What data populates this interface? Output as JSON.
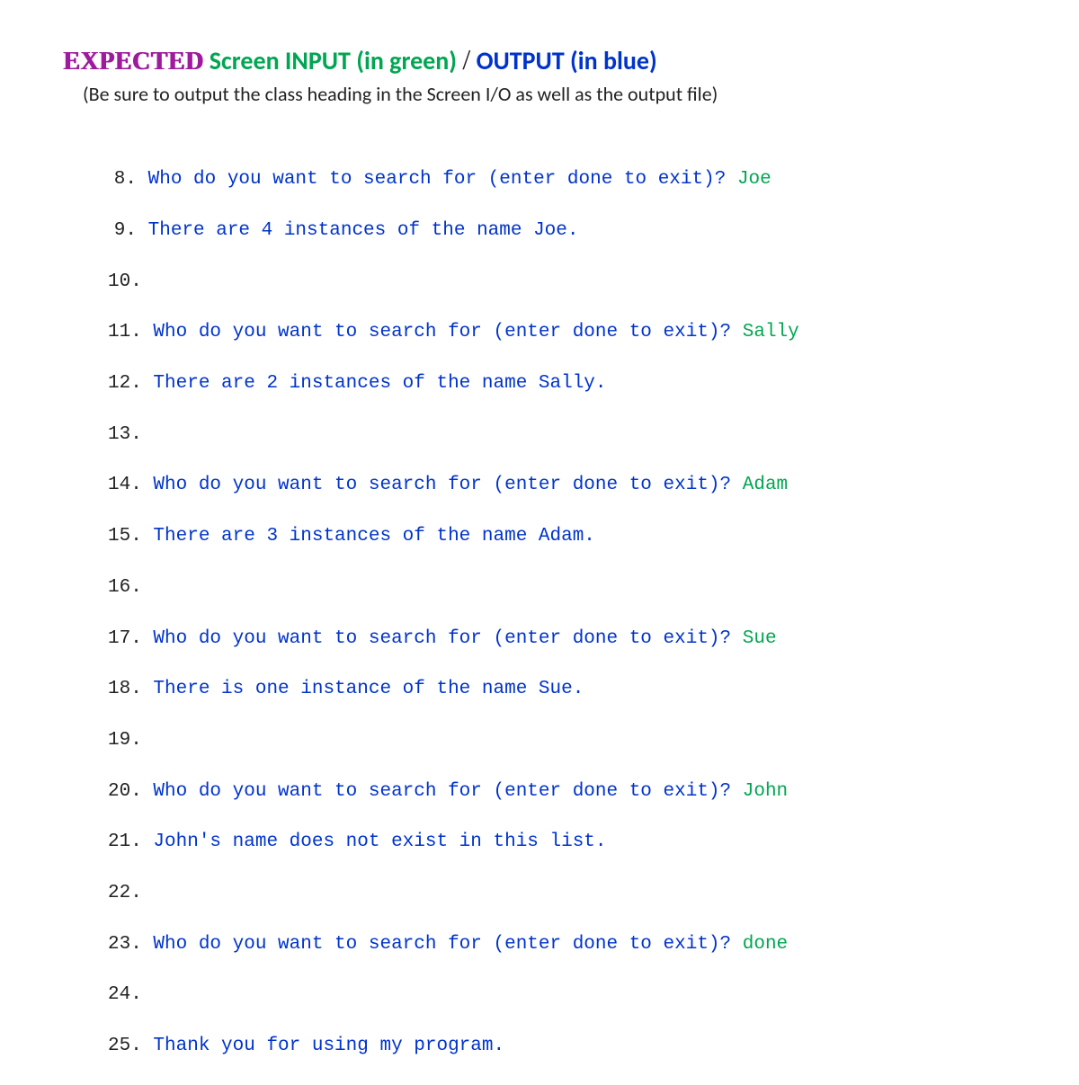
{
  "heading": {
    "expected": "EXPECTED",
    "input_part": " Screen INPUT (in green) ",
    "slash": "/",
    "output_part": " OUTPUT (in blue)"
  },
  "subheading": "(Be sure to output the class heading in the Screen I/O as well as the output file)",
  "lines": [
    {
      "num": "8.",
      "prompt": "Who do you want to search for (enter done to exit)?",
      "input": "Joe"
    },
    {
      "num": "9.",
      "output": "There are 4 instances of the name Joe."
    },
    {
      "num": "10."
    },
    {
      "num": "11.",
      "prompt": "Who do you want to search for (enter done to exit)?",
      "input": "Sally"
    },
    {
      "num": "12.",
      "output": "There are 2 instances of the name Sally."
    },
    {
      "num": "13."
    },
    {
      "num": "14.",
      "prompt": "Who do you want to search for (enter done to exit)?",
      "input": "Adam"
    },
    {
      "num": "15.",
      "output": "There are 3 instances of the name Adam."
    },
    {
      "num": "16."
    },
    {
      "num": "17.",
      "prompt": "Who do you want to search for (enter done to exit)?",
      "input": "Sue"
    },
    {
      "num": "18.",
      "output": "There is one instance of the name Sue."
    },
    {
      "num": "19."
    },
    {
      "num": "20.",
      "prompt": "Who do you want to search for (enter done to exit)?",
      "input": "John"
    },
    {
      "num": "21.",
      "output": "John's name does not exist in this list."
    },
    {
      "num": "22."
    },
    {
      "num": "23.",
      "prompt": "Who do you want to search for (enter done to exit)?",
      "input": "done"
    },
    {
      "num": "24."
    },
    {
      "num": "25.",
      "output": "Thank you for using my program."
    }
  ]
}
